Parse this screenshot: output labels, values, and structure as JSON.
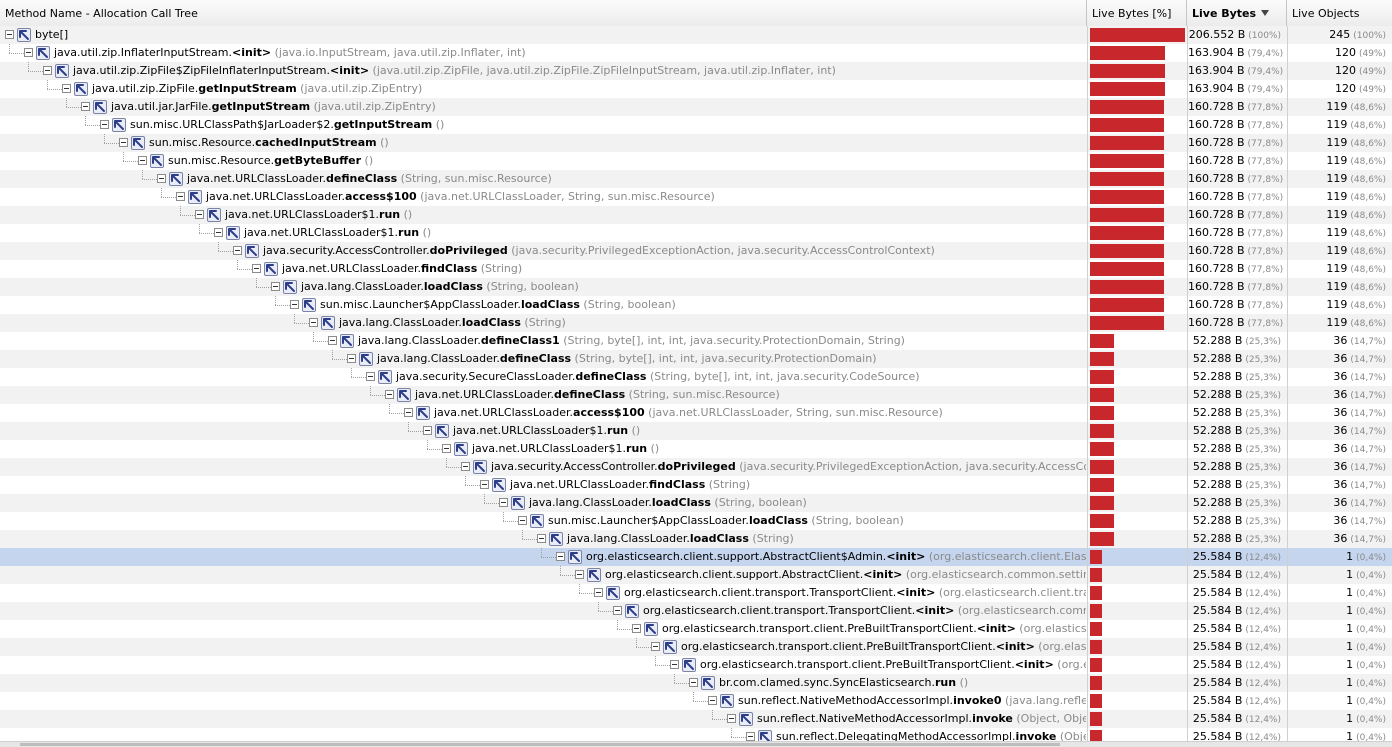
{
  "header": {
    "method_col": "Method Name - Allocation Call Tree",
    "bar_col": "Live Bytes [%]",
    "bytes_col": "Live Bytes",
    "objects_col": "Live Objects"
  },
  "colors": {
    "bar": "#c8272c",
    "selected_row": "#c5d5ee",
    "dim_text": "#8a8a8a"
  },
  "icons": {
    "node": "allocation-arrow-icon",
    "expand": "collapse-toggle-icon"
  },
  "rows": [
    {
      "depth": 0,
      "cls": "byte[]",
      "meth": "",
      "sig": "",
      "bytes": "206.552 B",
      "bpct": "(100%)",
      "objs": "245",
      "opct": "(100%)",
      "bar": 1.0,
      "sel": false
    },
    {
      "depth": 1,
      "cls": "java.util.zip.InflaterInputStream.",
      "meth": "<init>",
      "sig": "(java.io.InputStream, java.util.zip.Inflater, int)",
      "bytes": "163.904 B",
      "bpct": "(79,4%)",
      "objs": "120",
      "opct": "(49%)",
      "bar": 0.794,
      "sel": false
    },
    {
      "depth": 2,
      "cls": "java.util.zip.ZipFile$ZipFileInflaterInputStream.",
      "meth": "<init>",
      "sig": "(java.util.zip.ZipFile, java.util.zip.ZipFile.ZipFileInputStream, java.util.zip.Inflater, int)",
      "bytes": "163.904 B",
      "bpct": "(79,4%)",
      "objs": "120",
      "opct": "(49%)",
      "bar": 0.794,
      "sel": false
    },
    {
      "depth": 3,
      "cls": "java.util.zip.ZipFile.",
      "meth": "getInputStream",
      "sig": "(java.util.zip.ZipEntry)",
      "bytes": "163.904 B",
      "bpct": "(79,4%)",
      "objs": "120",
      "opct": "(49%)",
      "bar": 0.794,
      "sel": false
    },
    {
      "depth": 4,
      "cls": "java.util.jar.JarFile.",
      "meth": "getInputStream",
      "sig": "(java.util.zip.ZipEntry)",
      "bytes": "160.728 B",
      "bpct": "(77,8%)",
      "objs": "119",
      "opct": "(48,6%)",
      "bar": 0.778,
      "sel": false
    },
    {
      "depth": 5,
      "cls": "sun.misc.URLClassPath$JarLoader$2.",
      "meth": "getInputStream",
      "sig": "()",
      "bytes": "160.728 B",
      "bpct": "(77,8%)",
      "objs": "119",
      "opct": "(48,6%)",
      "bar": 0.778,
      "sel": false
    },
    {
      "depth": 6,
      "cls": "sun.misc.Resource.",
      "meth": "cachedInputStream",
      "sig": "()",
      "bytes": "160.728 B",
      "bpct": "(77,8%)",
      "objs": "119",
      "opct": "(48,6%)",
      "bar": 0.778,
      "sel": false
    },
    {
      "depth": 7,
      "cls": "sun.misc.Resource.",
      "meth": "getByteBuffer",
      "sig": "()",
      "bytes": "160.728 B",
      "bpct": "(77,8%)",
      "objs": "119",
      "opct": "(48,6%)",
      "bar": 0.778,
      "sel": false
    },
    {
      "depth": 8,
      "cls": "java.net.URLClassLoader.",
      "meth": "defineClass",
      "sig": "(String, sun.misc.Resource)",
      "bytes": "160.728 B",
      "bpct": "(77,8%)",
      "objs": "119",
      "opct": "(48,6%)",
      "bar": 0.778,
      "sel": false
    },
    {
      "depth": 9,
      "cls": "java.net.URLClassLoader.",
      "meth": "access$100",
      "sig": "(java.net.URLClassLoader, String, sun.misc.Resource)",
      "bytes": "160.728 B",
      "bpct": "(77,8%)",
      "objs": "119",
      "opct": "(48,6%)",
      "bar": 0.778,
      "sel": false
    },
    {
      "depth": 10,
      "cls": "java.net.URLClassLoader$1.",
      "meth": "run",
      "sig": "()",
      "bytes": "160.728 B",
      "bpct": "(77,8%)",
      "objs": "119",
      "opct": "(48,6%)",
      "bar": 0.778,
      "sel": false
    },
    {
      "depth": 11,
      "cls": "java.net.URLClassLoader$1.",
      "meth": "run",
      "sig": "()",
      "bytes": "160.728 B",
      "bpct": "(77,8%)",
      "objs": "119",
      "opct": "(48,6%)",
      "bar": 0.778,
      "sel": false
    },
    {
      "depth": 12,
      "cls": "java.security.AccessController.",
      "meth": "doPrivileged",
      "sig": "(java.security.PrivilegedExceptionAction, java.security.AccessControlContext)",
      "bytes": "160.728 B",
      "bpct": "(77,8%)",
      "objs": "119",
      "opct": "(48,6%)",
      "bar": 0.778,
      "sel": false
    },
    {
      "depth": 13,
      "cls": "java.net.URLClassLoader.",
      "meth": "findClass",
      "sig": "(String)",
      "bytes": "160.728 B",
      "bpct": "(77,8%)",
      "objs": "119",
      "opct": "(48,6%)",
      "bar": 0.778,
      "sel": false
    },
    {
      "depth": 14,
      "cls": "java.lang.ClassLoader.",
      "meth": "loadClass",
      "sig": "(String, boolean)",
      "bytes": "160.728 B",
      "bpct": "(77,8%)",
      "objs": "119",
      "opct": "(48,6%)",
      "bar": 0.778,
      "sel": false
    },
    {
      "depth": 15,
      "cls": "sun.misc.Launcher$AppClassLoader.",
      "meth": "loadClass",
      "sig": "(String, boolean)",
      "bytes": "160.728 B",
      "bpct": "(77,8%)",
      "objs": "119",
      "opct": "(48,6%)",
      "bar": 0.778,
      "sel": false
    },
    {
      "depth": 16,
      "cls": "java.lang.ClassLoader.",
      "meth": "loadClass",
      "sig": "(String)",
      "bytes": "160.728 B",
      "bpct": "(77,8%)",
      "objs": "119",
      "opct": "(48,6%)",
      "bar": 0.778,
      "sel": false
    },
    {
      "depth": 17,
      "cls": "java.lang.ClassLoader.",
      "meth": "defineClass1",
      "sig": "(String, byte[], int, int, java.security.ProtectionDomain, String)",
      "bytes": "52.288 B",
      "bpct": "(25,3%)",
      "objs": "36",
      "opct": "(14,7%)",
      "bar": 0.253,
      "sel": false
    },
    {
      "depth": 18,
      "cls": "java.lang.ClassLoader.",
      "meth": "defineClass",
      "sig": "(String, byte[], int, int, java.security.ProtectionDomain)",
      "bytes": "52.288 B",
      "bpct": "(25,3%)",
      "objs": "36",
      "opct": "(14,7%)",
      "bar": 0.253,
      "sel": false
    },
    {
      "depth": 19,
      "cls": "java.security.SecureClassLoader.",
      "meth": "defineClass",
      "sig": "(String, byte[], int, int, java.security.CodeSource)",
      "bytes": "52.288 B",
      "bpct": "(25,3%)",
      "objs": "36",
      "opct": "(14,7%)",
      "bar": 0.253,
      "sel": false
    },
    {
      "depth": 20,
      "cls": "java.net.URLClassLoader.",
      "meth": "defineClass",
      "sig": "(String, sun.misc.Resource)",
      "bytes": "52.288 B",
      "bpct": "(25,3%)",
      "objs": "36",
      "opct": "(14,7%)",
      "bar": 0.253,
      "sel": false
    },
    {
      "depth": 21,
      "cls": "java.net.URLClassLoader.",
      "meth": "access$100",
      "sig": "(java.net.URLClassLoader, String, sun.misc.Resource)",
      "bytes": "52.288 B",
      "bpct": "(25,3%)",
      "objs": "36",
      "opct": "(14,7%)",
      "bar": 0.253,
      "sel": false
    },
    {
      "depth": 22,
      "cls": "java.net.URLClassLoader$1.",
      "meth": "run",
      "sig": "()",
      "bytes": "52.288 B",
      "bpct": "(25,3%)",
      "objs": "36",
      "opct": "(14,7%)",
      "bar": 0.253,
      "sel": false
    },
    {
      "depth": 23,
      "cls": "java.net.URLClassLoader$1.",
      "meth": "run",
      "sig": "()",
      "bytes": "52.288 B",
      "bpct": "(25,3%)",
      "objs": "36",
      "opct": "(14,7%)",
      "bar": 0.253,
      "sel": false
    },
    {
      "depth": 24,
      "cls": "java.security.AccessController.",
      "meth": "doPrivileged",
      "sig": "(java.security.PrivilegedExceptionAction, java.security.AccessControlContext)",
      "bytes": "52.288 B",
      "bpct": "(25,3%)",
      "objs": "36",
      "opct": "(14,7%)",
      "bar": 0.253,
      "sel": false
    },
    {
      "depth": 25,
      "cls": "java.net.URLClassLoader.",
      "meth": "findClass",
      "sig": "(String)",
      "bytes": "52.288 B",
      "bpct": "(25,3%)",
      "objs": "36",
      "opct": "(14,7%)",
      "bar": 0.253,
      "sel": false
    },
    {
      "depth": 26,
      "cls": "java.lang.ClassLoader.",
      "meth": "loadClass",
      "sig": "(String, boolean)",
      "bytes": "52.288 B",
      "bpct": "(25,3%)",
      "objs": "36",
      "opct": "(14,7%)",
      "bar": 0.253,
      "sel": false
    },
    {
      "depth": 27,
      "cls": "sun.misc.Launcher$AppClassLoader.",
      "meth": "loadClass",
      "sig": "(String, boolean)",
      "bytes": "52.288 B",
      "bpct": "(25,3%)",
      "objs": "36",
      "opct": "(14,7%)",
      "bar": 0.253,
      "sel": false
    },
    {
      "depth": 28,
      "cls": "java.lang.ClassLoader.",
      "meth": "loadClass",
      "sig": "(String)",
      "bytes": "52.288 B",
      "bpct": "(25,3%)",
      "objs": "36",
      "opct": "(14,7%)",
      "bar": 0.253,
      "sel": false
    },
    {
      "depth": 29,
      "cls": "org.elasticsearch.client.support.AbstractClient$Admin.",
      "meth": "<init>",
      "sig": "(org.elasticsearch.client.ElasticsearchClient)",
      "bytes": "25.584 B",
      "bpct": "(12,4%)",
      "objs": "1",
      "opct": "(0,4%)",
      "bar": 0.124,
      "sel": true
    },
    {
      "depth": 30,
      "cls": "org.elasticsearch.client.support.AbstractClient.",
      "meth": "<init>",
      "sig": "(org.elasticsearch.common.settings.Settings, or",
      "bytes": "25.584 B",
      "bpct": "(12,4%)",
      "objs": "1",
      "opct": "(0,4%)",
      "bar": 0.124,
      "sel": false
    },
    {
      "depth": 31,
      "cls": "org.elasticsearch.client.transport.TransportClient.",
      "meth": "<init>",
      "sig": "(org.elasticsearch.client.transport.Trans",
      "bytes": "25.584 B",
      "bpct": "(12,4%)",
      "objs": "1",
      "opct": "(0,4%)",
      "bar": 0.124,
      "sel": false
    },
    {
      "depth": 32,
      "cls": "org.elasticsearch.client.transport.TransportClient.",
      "meth": "<init>",
      "sig": "(org.elasticsearch.common.settings.S",
      "bytes": "25.584 B",
      "bpct": "(12,4%)",
      "objs": "1",
      "opct": "(0,4%)",
      "bar": 0.124,
      "sel": false
    },
    {
      "depth": 33,
      "cls": "org.elasticsearch.transport.client.PreBuiltTransportClient.",
      "meth": "<init>",
      "sig": "(org.elasticsearch.commo",
      "bytes": "25.584 B",
      "bpct": "(12,4%)",
      "objs": "1",
      "opct": "(0,4%)",
      "bar": 0.124,
      "sel": false
    },
    {
      "depth": 34,
      "cls": "org.elasticsearch.transport.client.PreBuiltTransportClient.",
      "meth": "<init>",
      "sig": "(org.elasticsearch.co",
      "bytes": "25.584 B",
      "bpct": "(12,4%)",
      "objs": "1",
      "opct": "(0,4%)",
      "bar": 0.124,
      "sel": false
    },
    {
      "depth": 35,
      "cls": "org.elasticsearch.transport.client.PreBuiltTransportClient.",
      "meth": "<init>",
      "sig": "(org.elasticsearch",
      "bytes": "25.584 B",
      "bpct": "(12,4%)",
      "objs": "1",
      "opct": "(0,4%)",
      "bar": 0.124,
      "sel": false
    },
    {
      "depth": 36,
      "cls": "br.com.clamed.sync.SyncElasticsearch.",
      "meth": "run",
      "sig": "()",
      "bytes": "25.584 B",
      "bpct": "(12,4%)",
      "objs": "1",
      "opct": "(0,4%)",
      "bar": 0.124,
      "sel": false
    },
    {
      "depth": 37,
      "cls": "sun.reflect.NativeMethodAccessorImpl.",
      "meth": "invoke0",
      "sig": "(java.lang.reflect.Method",
      "bytes": "25.584 B",
      "bpct": "(12,4%)",
      "objs": "1",
      "opct": "(0,4%)",
      "bar": 0.124,
      "sel": false
    },
    {
      "depth": 38,
      "cls": "sun.reflect.NativeMethodAccessorImpl.",
      "meth": "invoke",
      "sig": "(Object, Object[])",
      "bytes": "25.584 B",
      "bpct": "(12,4%)",
      "objs": "1",
      "opct": "(0,4%)",
      "bar": 0.124,
      "sel": false
    },
    {
      "depth": 39,
      "cls": "sun.reflect.DelegatingMethodAccessorImpl.",
      "meth": "invoke",
      "sig": "(Object, Object",
      "bytes": "25.584 B",
      "bpct": "(12,4%)",
      "objs": "1",
      "opct": "(0,4%)",
      "bar": 0.124,
      "sel": false
    }
  ]
}
